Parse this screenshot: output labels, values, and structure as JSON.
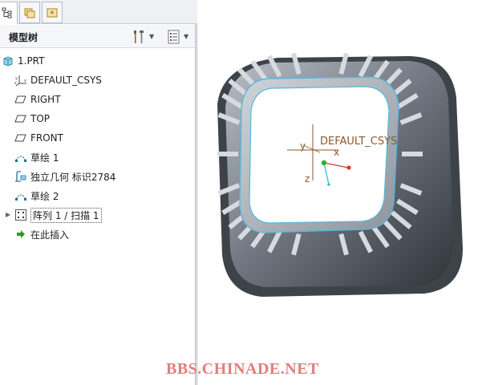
{
  "panel": {
    "tabs": [
      {
        "icon": "model-tree-tab-icon",
        "active": true
      },
      {
        "icon": "folder-browser-tab-icon",
        "active": false
      },
      {
        "icon": "favorites-tab-icon",
        "active": false
      }
    ],
    "title": "模型树"
  },
  "tree": {
    "items": [
      {
        "label": "1.PRT",
        "icon": "part-icon"
      },
      {
        "label": "DEFAULT_CSYS",
        "icon": "coordinate-system-icon"
      },
      {
        "label": "RIGHT",
        "icon": "datum-plane-icon"
      },
      {
        "label": "TOP",
        "icon": "datum-plane-icon"
      },
      {
        "label": "FRONT",
        "icon": "datum-plane-icon"
      },
      {
        "label": "草绘 1",
        "icon": "sketch-icon"
      },
      {
        "label": "独立几何 标识2784",
        "icon": "independent-geometry-icon"
      },
      {
        "label": "草绘 2",
        "icon": "sketch-icon"
      },
      {
        "label": "阵列 1 / 扫描 1",
        "icon": "pattern-icon"
      },
      {
        "label": "在此插入",
        "icon": "insert-here-arrow-icon"
      }
    ]
  },
  "viewport": {
    "csys_label": "DEFAULT_CSYS",
    "axis_x": "x",
    "axis_y": "y",
    "axis_z": "z"
  },
  "watermark": "BBS.CHINADE.NET",
  "colors": {
    "model_dark": "#3e434a",
    "model_light": "#c9ced5",
    "edge_highlight": "#5ab7d8",
    "csys_label": "#8a5a2b",
    "watermark": "#e47d7d"
  }
}
